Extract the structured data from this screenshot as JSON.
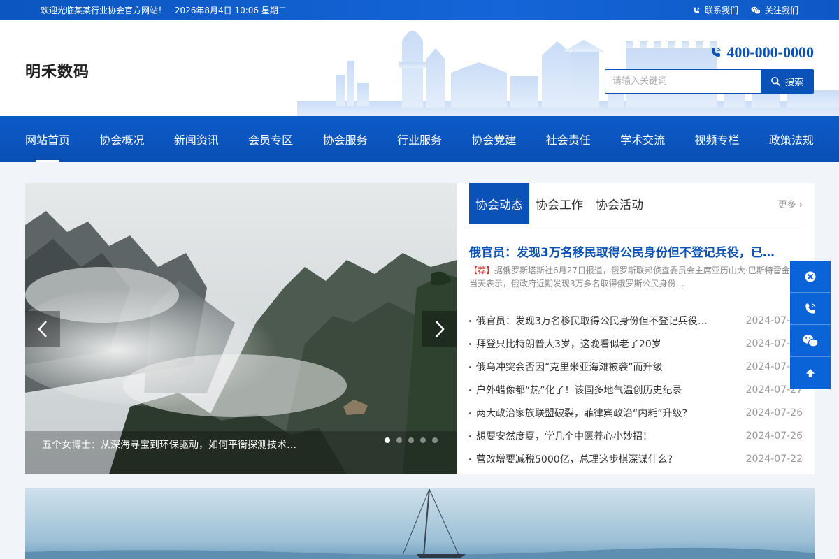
{
  "topbar": {
    "welcome": "欢迎光临某某行业协会官方网站！",
    "datetime": "2026年8月4日 10:06 星期二",
    "contact_label": "联系我们",
    "follow_label": "关注我们"
  },
  "header": {
    "logo_text": "明禾数码",
    "hotline": "400-000-0000",
    "search_placeholder": "请输入关键词",
    "search_button": "搜索"
  },
  "nav": {
    "items": [
      "网站首页",
      "协会概况",
      "新闻资讯",
      "会员专区",
      "协会服务",
      "行业服务",
      "协会党建",
      "社会责任",
      "学术交流",
      "视频专栏",
      "政策法规"
    ],
    "active_index": 0
  },
  "slider": {
    "caption": "五个女博士：从深海寻宝到环保驱动，如何平衡探测技术…",
    "prev_symbol": "‹",
    "next_symbol": "›",
    "dot_count": 5,
    "active_dot": 0
  },
  "news": {
    "tabs": [
      "协会动态",
      "协会工作",
      "协会活动"
    ],
    "active_tab": 0,
    "more_label": "更多 ›",
    "headline": "俄官员：发现3万名移民取得公民身份但不登记兵役，已…",
    "summary_tag": "【荐】",
    "summary_text": "据俄罗斯塔斯社6月27日报道，俄罗斯联邦侦查委员会主席亚历山大·巴斯特雷金当天表示，俄政府近期发现3万多名取得俄罗斯公民身份…",
    "items": [
      {
        "title": "俄官员：发现3万名移民取得公民身份但不登记兵役…",
        "date": "2024-07-28"
      },
      {
        "title": "拜登只比特朗普大3岁，这晚看似老了20岁",
        "date": "2024-07-28"
      },
      {
        "title": "俄乌冲突会否因“克里米亚海滩被袭”而升级",
        "date": "2024-07-27"
      },
      {
        "title": "户外蜡像都“热”化了！该国多地气温创历史纪录",
        "date": "2024-07-27"
      },
      {
        "title": "两大政治家族联盟破裂，菲律宾政治“内耗”升级?",
        "date": "2024-07-26"
      },
      {
        "title": "想要安然度夏，学几个中医养心小妙招！",
        "date": "2024-07-26"
      },
      {
        "title": "营改增要减税5000亿，总理这步棋深谋什么?",
        "date": "2024-07-22"
      }
    ]
  },
  "floatbar": {
    "icons": [
      "close-circle-icon",
      "phone-icon",
      "wechat-icon",
      "arrow-up-icon"
    ]
  },
  "colors": {
    "brand_blue": "#0b52b8",
    "accent_red": "#d0312d",
    "page_bg": "#f1f4f9"
  }
}
